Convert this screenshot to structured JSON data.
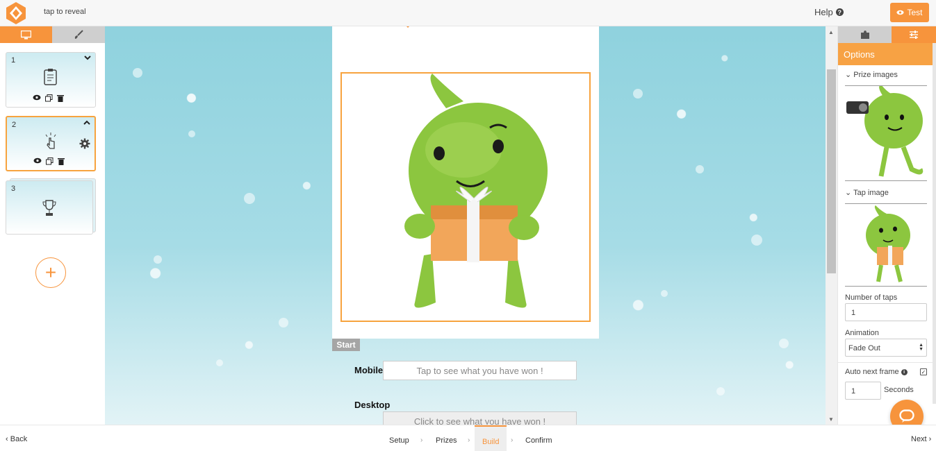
{
  "header": {
    "app_title": "tap to reveal",
    "help_label": "Help",
    "test_label": "Test"
  },
  "left_panel": {
    "tabs": [
      {
        "name": "desktop",
        "icon": "monitor-icon",
        "active": true
      },
      {
        "name": "design",
        "icon": "brush-icon",
        "active": false
      }
    ],
    "frames": [
      {
        "number": "1",
        "icon": "clipboard-icon",
        "expanded": false,
        "selected": false
      },
      {
        "number": "2",
        "icon": "tap-icon",
        "expanded": true,
        "selected": true
      },
      {
        "number": "3",
        "icon": "trophy-icon",
        "stacked": true
      }
    ],
    "add_label": "+"
  },
  "canvas": {
    "start_tag": "Start",
    "mobile_label": "Mobile",
    "mobile_value": "Tap to see what you have won !",
    "desktop_label": "Desktop",
    "desktop_value": "Click to see what you have won !"
  },
  "right_panel": {
    "tabs": [
      {
        "name": "elements",
        "icon": "puzzle-icon",
        "active": false
      },
      {
        "name": "options",
        "icon": "sliders-icon",
        "active": true
      }
    ],
    "options_title": "Options",
    "prize_images_label": "Prize images",
    "tap_image_label": "Tap image",
    "number_of_taps_label": "Number of taps",
    "number_of_taps_value": "1",
    "animation_label": "Animation",
    "animation_value": "Fade Out",
    "auto_next_label": "Auto next frame",
    "auto_next_checked": true,
    "seconds_value": "1",
    "seconds_label": "Seconds"
  },
  "footer": {
    "back_label": "Back",
    "next_label": "Next",
    "steps": [
      "Setup",
      "Prizes",
      "Build",
      "Confirm"
    ],
    "active_step": "Build"
  },
  "colors": {
    "accent": "#f7943c",
    "character_green": "#8cc63f",
    "background_sky": "#a6dce6"
  }
}
